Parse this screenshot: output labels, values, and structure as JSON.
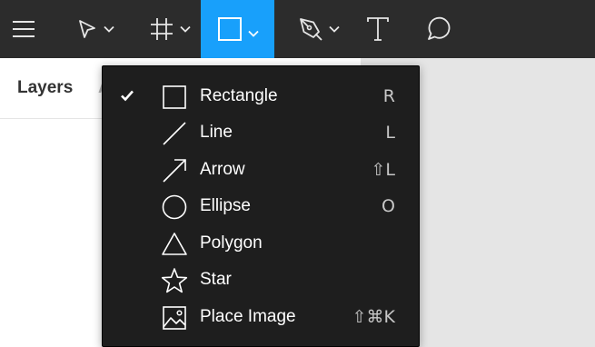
{
  "toolbar": {
    "tools": [
      {
        "name": "main-menu-icon"
      },
      {
        "name": "move-tool-icon"
      },
      {
        "name": "frame-tool-icon"
      },
      {
        "name": "rectangle-tool-icon",
        "active": true
      },
      {
        "name": "pen-tool-icon"
      },
      {
        "name": "text-tool-icon"
      },
      {
        "name": "comment-tool-icon"
      }
    ],
    "accent": "#18a0fb",
    "background": "#2c2c2c"
  },
  "left_panel": {
    "tab_layers": "Layers",
    "tab_assets_partial": "A"
  },
  "shape_menu": {
    "items": [
      {
        "label": "Rectangle",
        "shortcut": "R",
        "icon": "rectangle-icon",
        "checked": true
      },
      {
        "label": "Line",
        "shortcut": "L",
        "icon": "line-icon",
        "checked": false
      },
      {
        "label": "Arrow",
        "shortcut": "⇧L",
        "icon": "arrow-icon",
        "checked": false
      },
      {
        "label": "Ellipse",
        "shortcut": "O",
        "icon": "ellipse-icon",
        "checked": false
      },
      {
        "label": "Polygon",
        "shortcut": "",
        "icon": "polygon-icon",
        "checked": false
      },
      {
        "label": "Star",
        "shortcut": "",
        "icon": "star-icon",
        "checked": false
      },
      {
        "label": "Place Image",
        "shortcut": "⇧⌘K",
        "icon": "image-icon",
        "checked": false
      }
    ]
  }
}
